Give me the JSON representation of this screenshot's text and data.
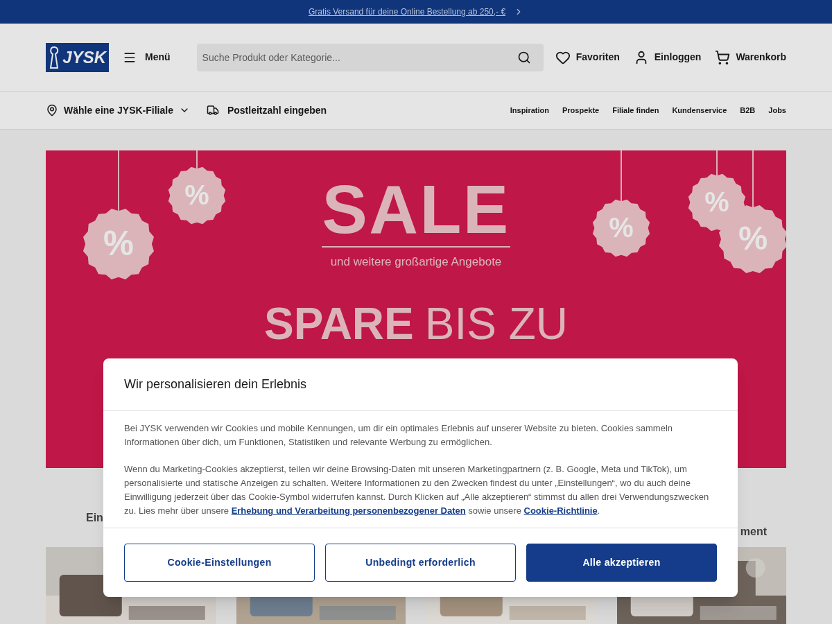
{
  "promo_bar": {
    "text": "Gratis Versand für deine Online Bestellung ab 250,- €"
  },
  "header": {
    "logo": "JYSK",
    "menu": "Menü",
    "search": {
      "placeholder": "Suche Produkt oder Kategorie..."
    },
    "actions": [
      {
        "kind": "heart",
        "label": "Favoriten"
      },
      {
        "kind": "user",
        "label": "Einloggen"
      },
      {
        "kind": "cart",
        "label": "Warenkorb"
      }
    ]
  },
  "subnav": {
    "store": "Wähle eine JYSK-Filiale",
    "postcode": "Postleitzahl eingeben",
    "links": [
      "Inspiration",
      "Prospekte",
      "Filiale finden",
      "Kundenservice",
      "B2B",
      "Jobs"
    ]
  },
  "banner": {
    "title": "SALE",
    "subtitle": "und weitere großartige Angebote",
    "headline_bold": "SPARE",
    "headline_light": "BIS ZU",
    "tag_symbol": "%"
  },
  "section_headings": [
    "Ein",
    "ment"
  ],
  "products": [
    {
      "kind": "picture"
    },
    {
      "kind": "picture"
    },
    {
      "kind": "picture"
    },
    {
      "kind": "picture"
    }
  ],
  "cookie_dialog": {
    "title": "Wir personalisieren dein Erlebnis",
    "paragraph_1": "Bei JYSK verwenden wir Cookies und mobile Kennungen, um dir ein optimales Erlebnis auf unserer Website zu bieten. Cookies sammeln Informationen über dich, um Funktionen, Statistiken und relevante Werbung zu ermöglichen.",
    "paragraph_2": [
      "Wenn du Marketing-Cookies akzeptierst, teilen wir deine Browsing-Daten mit unseren Marketingpartnern (z. B. Google, Meta und TikTok), um personalisierte und statische Anzeigen zu schalten. Weitere Informationen zu den Zwecken findest du unter „Einstellungen“, wo du auch deine Einwilligung jederzeit über das Cookie-Symbol widerrufen kannst. Durch Klicken auf „Alle akzeptieren“ stimmst du allen drei Verwendungszwecken zu. Lies mehr über unsere ",
      {
        "link": "Erhebung und Verarbeitung personenbezogener Daten"
      },
      " sowie unsere ",
      {
        "link": "Cookie-Richtlinie"
      },
      "."
    ],
    "buttons": [
      {
        "label": "Cookie-Einstellungen",
        "primary": false
      },
      {
        "label": "Unbedingt erforderlich",
        "primary": false
      },
      {
        "label": "Alle akzeptieren",
        "primary": true
      }
    ]
  }
}
